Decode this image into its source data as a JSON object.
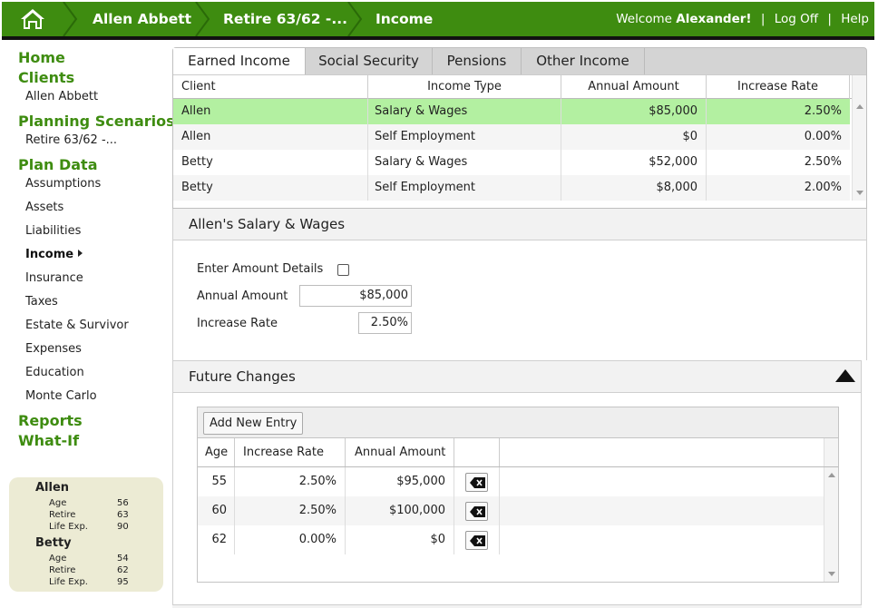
{
  "topbar": {
    "crumbs": [
      "Allen Abbett",
      "Retire 63/62 -...",
      "Income"
    ],
    "welcome_prefix": "Welcome",
    "user": "Alexander!",
    "logoff": "Log Off",
    "help": "Help",
    "brand_color": "#3e8c10"
  },
  "sidebar": {
    "home": "Home",
    "clients": "Clients",
    "client_name": "Allen Abbett",
    "planning": "Planning Scenarios",
    "scenario": "Retire 63/62 -...",
    "plan_data": "Plan Data",
    "items": [
      "Assumptions",
      "Assets",
      "Liabilities",
      "Income",
      "Insurance",
      "Taxes",
      "Estate & Survivor",
      "Expenses",
      "Education",
      "Monte Carlo"
    ],
    "reports": "Reports",
    "whatif": "What-If"
  },
  "people": [
    {
      "name": "Allen",
      "age_label": "Age",
      "age": "56",
      "retire_label": "Retire",
      "retire": "63",
      "life_label": "Life Exp.",
      "life": "90"
    },
    {
      "name": "Betty",
      "age_label": "Age",
      "age": "54",
      "retire_label": "Retire",
      "retire": "62",
      "life_label": "Life Exp.",
      "life": "95"
    }
  ],
  "tabs": [
    "Earned Income",
    "Social Security",
    "Pensions",
    "Other Income"
  ],
  "income_grid": {
    "headers": [
      "Client",
      "Income Type",
      "Annual Amount",
      "Increase Rate"
    ],
    "rows": [
      {
        "client": "Allen",
        "type": "Salary & Wages",
        "amount": "$85,000",
        "rate": "2.50%"
      },
      {
        "client": "Allen",
        "type": "Self Employment",
        "amount": "$0",
        "rate": "0.00%"
      },
      {
        "client": "Betty",
        "type": "Salary & Wages",
        "amount": "$52,000",
        "rate": "2.50%"
      },
      {
        "client": "Betty",
        "type": "Self Employment",
        "amount": "$8,000",
        "rate": "2.00%"
      }
    ],
    "selected_color": "#b3f0a1"
  },
  "detail": {
    "title": "Allen's Salary & Wages",
    "enter_details_label": "Enter Amount Details",
    "annual_label": "Annual Amount",
    "annual_value": "$85,000",
    "rate_label": "Increase Rate",
    "rate_value": "2.50%"
  },
  "future": {
    "title": "Future Changes",
    "add_button": "Add New Entry",
    "headers": [
      "Age",
      "Increase Rate",
      "Annual Amount"
    ],
    "rows": [
      {
        "age": "55",
        "rate": "2.50%",
        "amount": "$95,000"
      },
      {
        "age": "60",
        "rate": "2.50%",
        "amount": "$100,000"
      },
      {
        "age": "62",
        "rate": "0.00%",
        "amount": "$0"
      }
    ]
  }
}
